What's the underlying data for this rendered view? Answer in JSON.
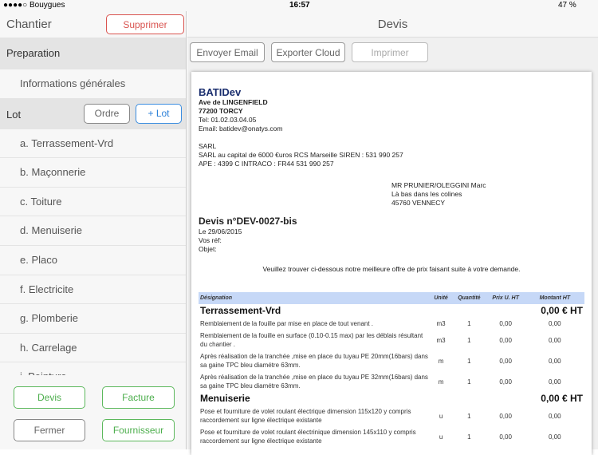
{
  "status": {
    "carrier": "●●●●○ Bouygues",
    "time": "16:57",
    "battery": "47 %"
  },
  "left": {
    "title": "Chantier",
    "delete": "Supprimer",
    "preparation": "Preparation",
    "info": "Informations générales",
    "lot": "Lot",
    "order": "Ordre",
    "add_lot": "+ Lot",
    "items": [
      "a. Terrassement-Vrd",
      "b. Maçonnerie",
      "c. Toiture",
      "d. Menuiserie",
      "e. Placo",
      "f. Electricite",
      "g. Plomberie",
      "h. Carrelage",
      "i. Peinture"
    ],
    "buttons": {
      "devis": "Devis",
      "facture": "Facture",
      "fermer": "Fermer",
      "fournisseur": "Fournisseur"
    }
  },
  "right": {
    "title": "Devis",
    "email": "Envoyer Email",
    "cloud": "Exporter Cloud",
    "print": "Imprimer"
  },
  "doc": {
    "company": "BATIDev",
    "addr1": "Ave de LINGENFIELD",
    "addr2": "77200 TORCY",
    "tel": "Tel: 01.02.03.04.05",
    "email": "Email: batidev@onatys.com",
    "legal1": "SARL",
    "legal2": "SARL au capital de 6000 €uros RCS Marseille SIREN : 531 990 257",
    "legal3": "APE : 4399 C INTRACO : FR44 531 990 257",
    "client1": "MR PRUNIER/OLEGGINI Marc",
    "client2": "Là bas dans les colines",
    "client3": "45760 VENNECY",
    "number": "Devis n°DEV-0027-bis",
    "date": "Le 29/06/2015",
    "ref": "Vos réf:",
    "object": "Objet:",
    "intro": "Veuillez trouver ci-dessous notre meilleure offre de prix faisant suite à votre demande.",
    "headers": [
      "Désignation",
      "Unité",
      "Quantité",
      "Prix U. HT",
      "Montant HT"
    ],
    "groups": [
      {
        "name": "Terrassement-Vrd",
        "total": "0,00 € HT",
        "rows": [
          [
            "Remblaiement de la fouille par mise en place de tout venant .",
            "m3",
            "1",
            "0,00",
            "0,00"
          ],
          [
            "Remblaiement de la fouille en surface (0.10-0.15 max) par les déblais résultant du chantier .",
            "m3",
            "1",
            "0,00",
            "0,00"
          ],
          [
            "Après réalisation de la tranchée ,mise en place du tuyau PE 20mm(16bars) dans sa gaine TPC bleu diamétre 63mm.",
            "m",
            "1",
            "0,00",
            "0,00"
          ],
          [
            "Après réalisation de la tranchée ,mise en place du tuyau PE 32mm(16bars) dans sa gaine TPC bleu diamétre 63mm.",
            "m",
            "1",
            "0,00",
            "0,00"
          ]
        ]
      },
      {
        "name": "Menuiserie",
        "total": "0,00 € HT",
        "rows": [
          [
            "Pose et fourniture de volet roulant électrique dimension 115x120 y compris raccordement sur ligne électrique existante",
            "u",
            "1",
            "0,00",
            "0,00"
          ],
          [
            "Pose et fourniture de volet roulant électrinique dimension 145x110 y compris raccordement sur ligne électrique existante",
            "u",
            "1",
            "0,00",
            "0,00"
          ]
        ]
      }
    ]
  }
}
